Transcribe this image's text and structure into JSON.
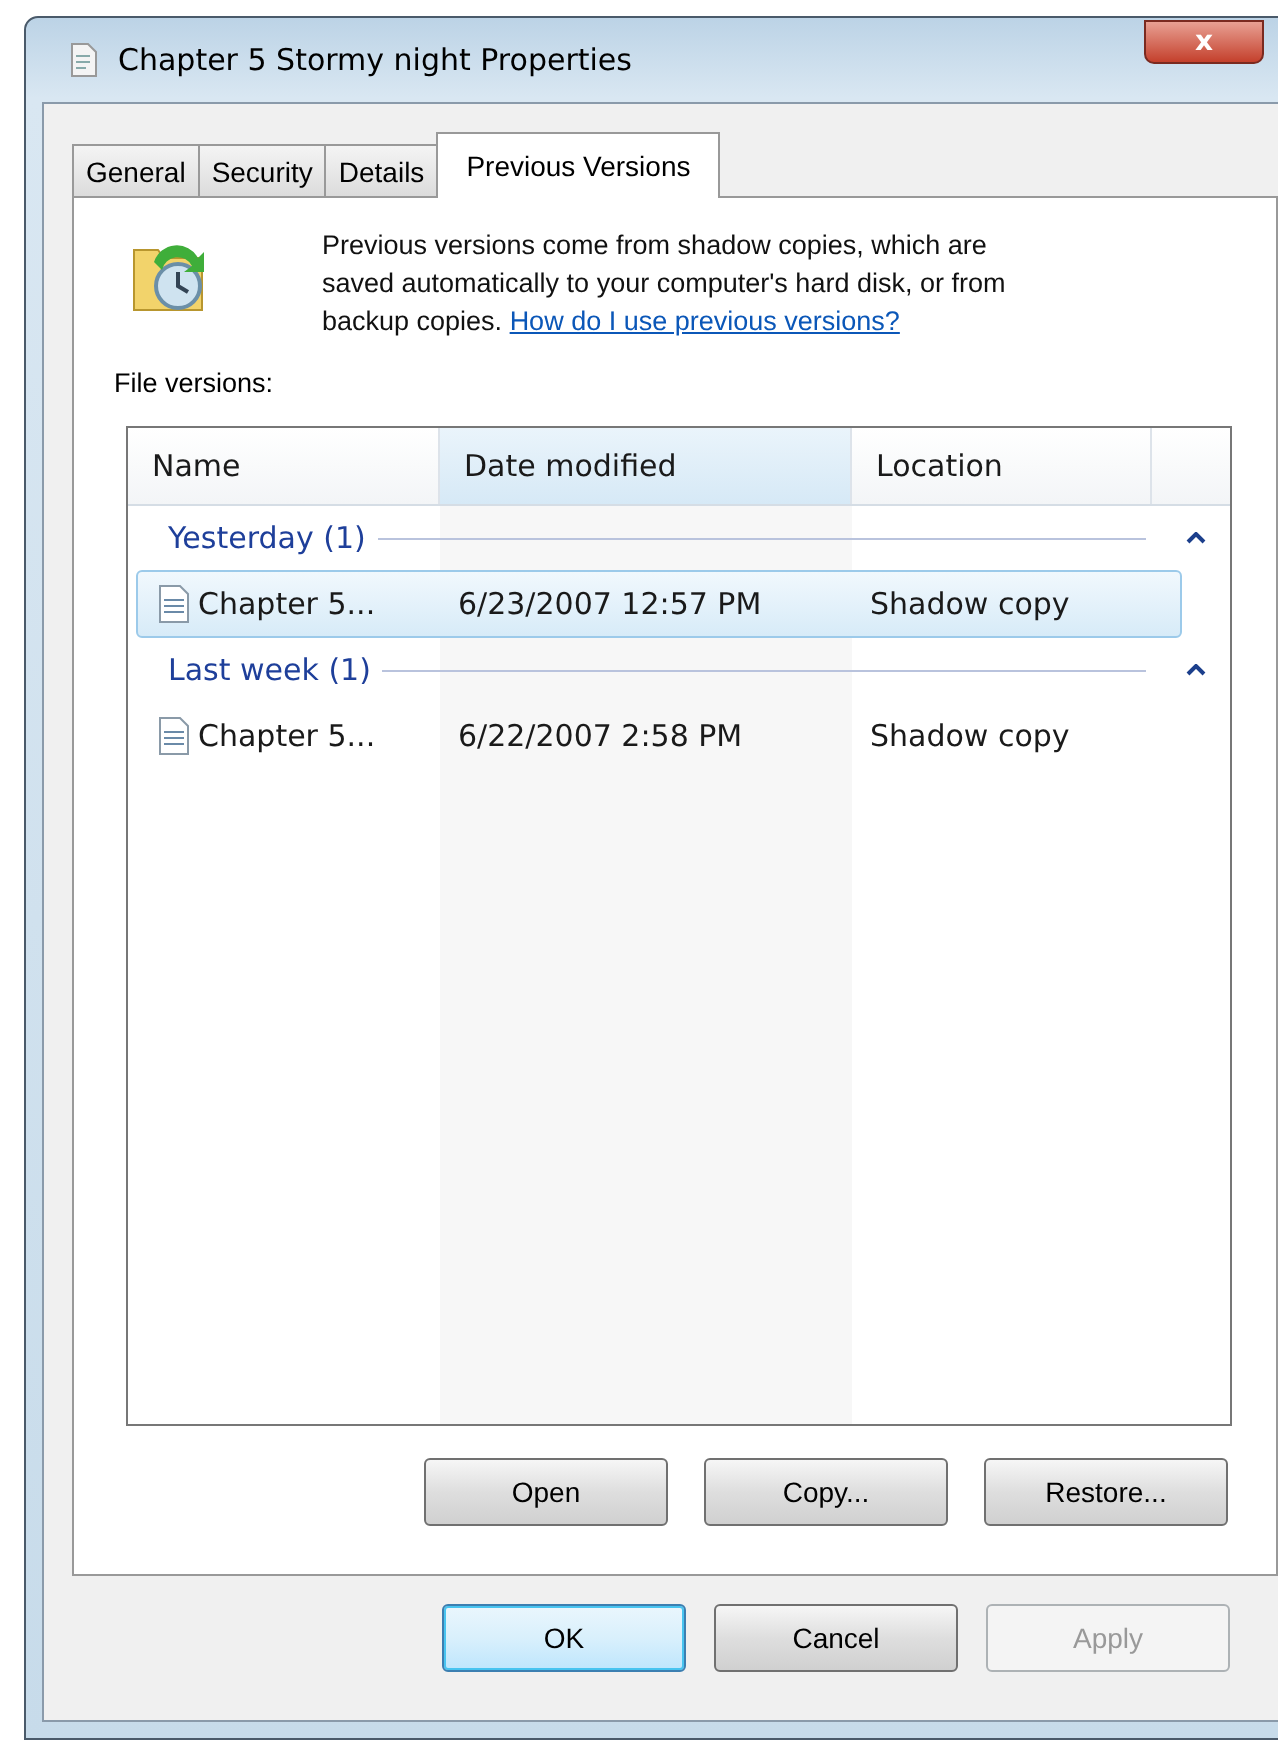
{
  "window": {
    "title": "Chapter 5 Stormy night Properties",
    "close": "x"
  },
  "tabs": [
    {
      "label": "General",
      "selected": false
    },
    {
      "label": "Security",
      "selected": false
    },
    {
      "label": "Details",
      "selected": false
    },
    {
      "label": "Previous Versions",
      "selected": true
    }
  ],
  "description": {
    "text": "Previous versions come from shadow copies, which are saved automatically to your computer's hard disk, or from backup copies.",
    "link": "How do I use previous versions?"
  },
  "list_label": "File versions:",
  "table": {
    "columns": [
      {
        "label": "Name",
        "sorted": false
      },
      {
        "label": "Date modified",
        "sorted": true
      },
      {
        "label": "Location",
        "sorted": false
      }
    ],
    "groups": [
      {
        "label": "Yesterday (1)",
        "expanded": true,
        "rows": [
          {
            "name": "Chapter 5...",
            "date": "6/23/2007 12:57 PM",
            "location": "Shadow copy",
            "selected": true
          }
        ]
      },
      {
        "label": "Last week (1)",
        "expanded": true,
        "rows": [
          {
            "name": "Chapter 5...",
            "date": "6/22/2007 2:58 PM",
            "location": "Shadow copy",
            "selected": false
          }
        ]
      }
    ]
  },
  "actions": [
    {
      "label": "Open",
      "default": false,
      "disabled": false
    },
    {
      "label": "Copy...",
      "default": false,
      "disabled": false
    },
    {
      "label": "Restore...",
      "default": false,
      "disabled": false
    }
  ],
  "buttons": [
    {
      "label": "OK",
      "default": true,
      "disabled": false
    },
    {
      "label": "Cancel",
      "default": false,
      "disabled": false
    },
    {
      "label": "Apply",
      "default": false,
      "disabled": true
    }
  ]
}
